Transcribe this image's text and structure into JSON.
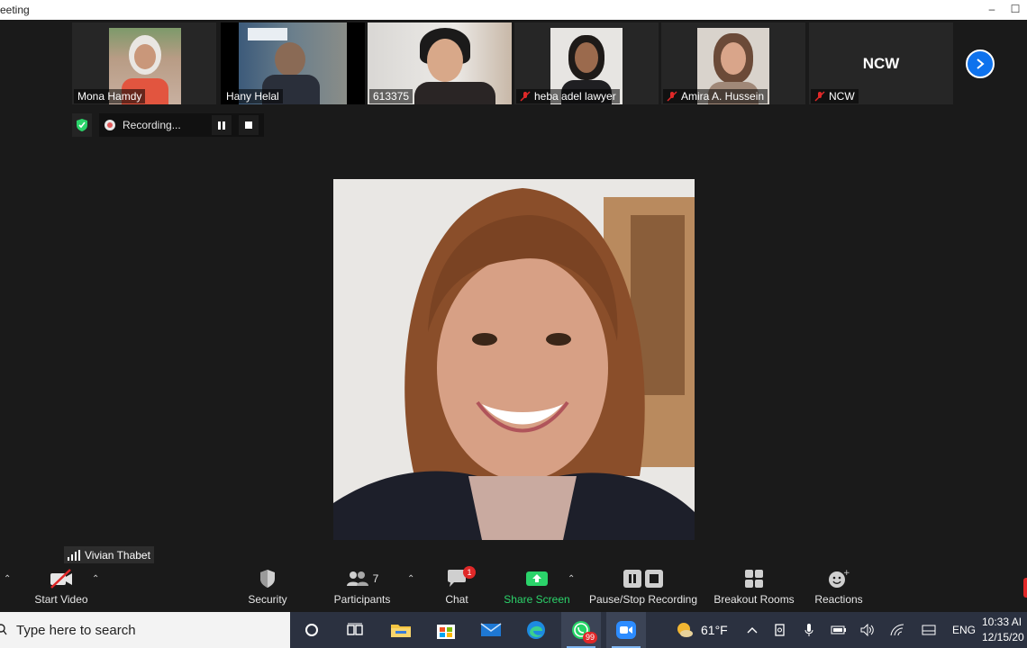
{
  "window": {
    "title": "eeting",
    "controls": [
      "–",
      "☐"
    ]
  },
  "participants": [
    {
      "name": "Mona Hamdy",
      "muted": false
    },
    {
      "name": "Hany Helal",
      "muted": false
    },
    {
      "name": "613375",
      "muted": false
    },
    {
      "name": "heba adel lawyer",
      "muted": true
    },
    {
      "name": "Amira A. Hussein",
      "muted": true
    },
    {
      "name": "NCW",
      "muted": true,
      "avatar_text": "NCW"
    }
  ],
  "recording": {
    "status": "Recording..."
  },
  "active_speaker": {
    "name": "Vivian Thabet"
  },
  "toolbar": {
    "start_video": "Start Video",
    "security": "Security",
    "participants": "Participants",
    "participants_count": "7",
    "chat": "Chat",
    "chat_badge": "1",
    "share_screen": "Share Screen",
    "recording": "Pause/Stop Recording",
    "breakout": "Breakout Rooms",
    "reactions": "Reactions"
  },
  "taskbar": {
    "search_placeholder": "Type here to search",
    "whatsapp_badge": "99",
    "weather": "61°F",
    "language": "ENG",
    "time": "10:33 AI",
    "date": "12/15/20"
  },
  "colors": {
    "accent_blue": "#0e72ed",
    "share_green": "#2bd36a",
    "badge_red": "#e02828"
  }
}
